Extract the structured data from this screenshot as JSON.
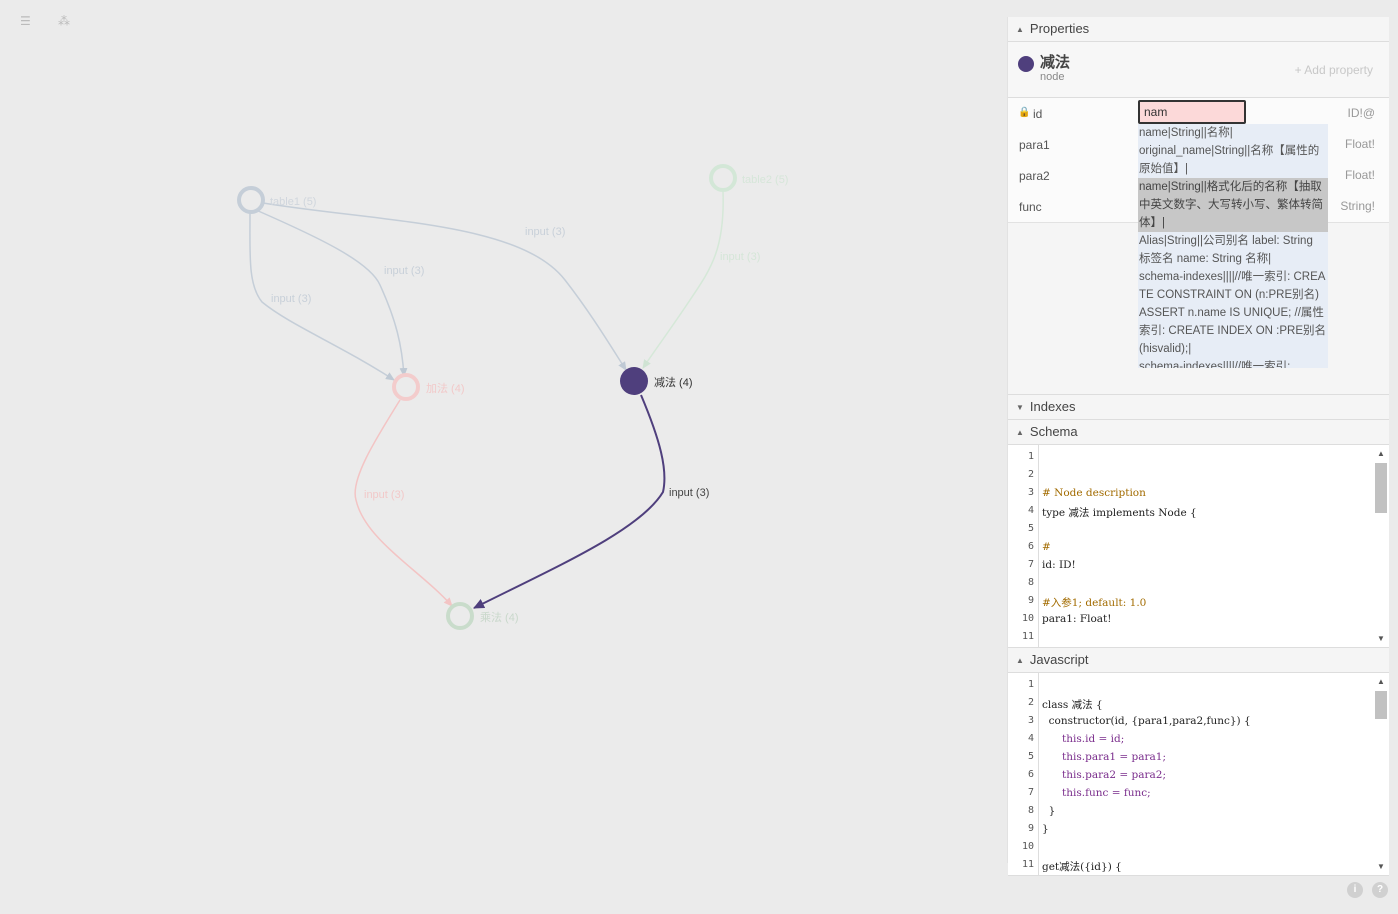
{
  "toolbar": {
    "menu_icon": "☰",
    "graph_icon": "⁂"
  },
  "graph": {
    "nodes": [
      {
        "key": "table1",
        "label": "table1 (5)",
        "faded": true
      },
      {
        "key": "table2",
        "label": "table2 (5)",
        "faded": true
      },
      {
        "key": "jiafa",
        "label": "加法 (4)",
        "faded": true
      },
      {
        "key": "jianfa",
        "label": "减法 (4)",
        "faded": false
      },
      {
        "key": "chengfa",
        "label": "乘法 (4)",
        "faded": true
      }
    ],
    "edges": [
      {
        "key": "e1",
        "label": "input (3)"
      },
      {
        "key": "e2",
        "label": "input (3)"
      },
      {
        "key": "e3",
        "label": "input (3)"
      },
      {
        "key": "e4",
        "label": "input (3)"
      },
      {
        "key": "e5",
        "label": "input (3)"
      },
      {
        "key": "e6",
        "label": "input (3)"
      }
    ]
  },
  "panel": {
    "properties": {
      "header": "Properties",
      "node_name": "减法",
      "node_type": "node",
      "add_property": "+ Add property",
      "rows": [
        {
          "key": "id",
          "type": "ID!@",
          "locked": true
        },
        {
          "key": "para1",
          "type": "Float!"
        },
        {
          "key": "para2",
          "type": "Float!"
        },
        {
          "key": "func",
          "type": "String!"
        }
      ],
      "id_value": "nam",
      "suggestions": [
        "name|String||名称|",
        "original_name|String||名称【属性的原始值】|",
        "name|String||格式化后的名称【抽取中英文数字、大写转小写、繁体转简体】|",
        "Alias|String||公司别名 label: String 标签名 name: String 名称|",
        "schema-indexes||||//唯一索引: CREATE CONSTRAINT ON (n:PRE别名) ASSERT n.name IS UNIQUE; //属性索引: CREATE INDEX ON :PRE别名(hisvalid);|",
        "schema-indexes||||//唯一索引:"
      ]
    },
    "indexes": {
      "header": "Indexes"
    },
    "schema": {
      "header": "Schema",
      "lines": [
        "",
        "",
        "# Node description",
        "type 减法 implements Node {",
        "",
        "#",
        "id: ID!",
        "",
        "#入参1; default: 1.0",
        "para1: Float!",
        ""
      ]
    },
    "javascript": {
      "header": "Javascript",
      "lines": [
        "",
        "class 减法 {",
        "  constructor(id, {para1,para2,func}) {",
        "      this.id = id;",
        "      this.para1 = para1;",
        "      this.para2 = para2;",
        "      this.func = func;",
        "  }",
        "}",
        "",
        "get减法({id}) {"
      ]
    }
  },
  "footer": {
    "info_label": "i",
    "help_label": "?"
  },
  "colors": {
    "accent": "#4f3f7d",
    "faded_edge": "#c5ced8",
    "pink": "#f3c4c4",
    "green": "#c9dccb"
  }
}
